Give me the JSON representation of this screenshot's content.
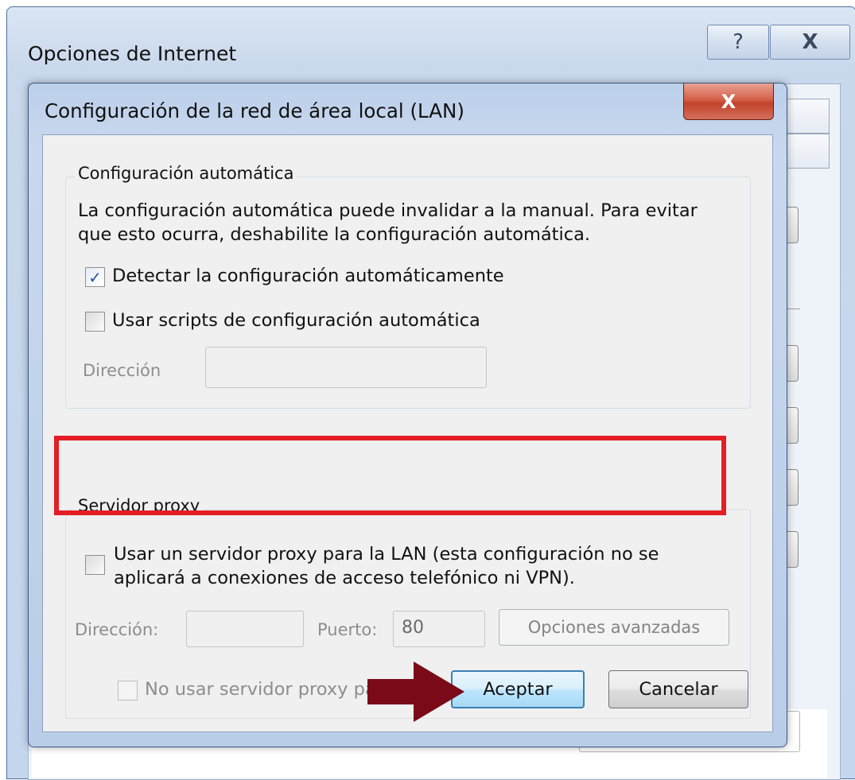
{
  "outer_window": {
    "title": "Opciones de Internet",
    "help_glyph": "?",
    "close_glyph": "X"
  },
  "dialog": {
    "title": "Configuración de la red de área local (LAN)",
    "close_glyph": "X",
    "auto_config": {
      "group_label": "Configuración automática",
      "description": [
        "La configuración automática puede invalidar a la manual. Para evitar",
        "que esto ocurra, deshabilite la configuración automática."
      ],
      "detect_label": "Detectar la configuración automáticamente",
      "detect_checked": true,
      "scripts_label": "Usar scripts de configuración automática",
      "scripts_checked": false,
      "address_label": "Dirección",
      "address_value": ""
    },
    "proxy": {
      "group_label": "Servidor proxy",
      "use_proxy_label": [
        "Usar un servidor proxy para la LAN (esta configuración no se",
        "aplicará a conexiones de acceso telefónico ni VPN)."
      ],
      "use_proxy_checked": false,
      "address_label": "Dirección:",
      "address_value": "",
      "port_label": "Puerto:",
      "port_value": "80",
      "advanced_button": "Opciones avanzadas",
      "bypass_local_label": "No usar servidor proxy para direcciones locales",
      "bypass_local_checked": false
    },
    "ok_button": "Aceptar",
    "cancel_button": "Cancelar"
  },
  "annotations": {
    "highlight_color": "#e31e24",
    "arrow_color": "#7a0a17"
  },
  "icons": {
    "check": "✓"
  }
}
